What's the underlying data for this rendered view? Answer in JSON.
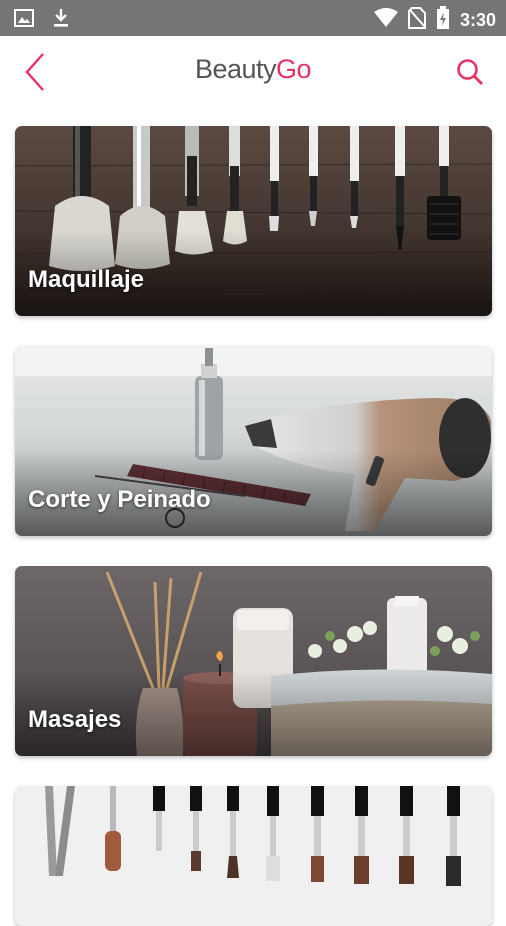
{
  "status_bar": {
    "time": "3:30",
    "icons": [
      "image-icon",
      "download-icon",
      "wifi-icon",
      "no-sim-icon",
      "battery-charging-icon"
    ]
  },
  "app_bar": {
    "title_part1": "Beauty",
    "title_part2": "Go",
    "back_icon": "chevron-left-icon",
    "search_icon": "search-icon",
    "accent_color": "#e63462"
  },
  "categories": [
    {
      "label": "Maquillaje"
    },
    {
      "label": "Corte y Peinado"
    },
    {
      "label": "Masajes"
    },
    {
      "label": ""
    }
  ]
}
